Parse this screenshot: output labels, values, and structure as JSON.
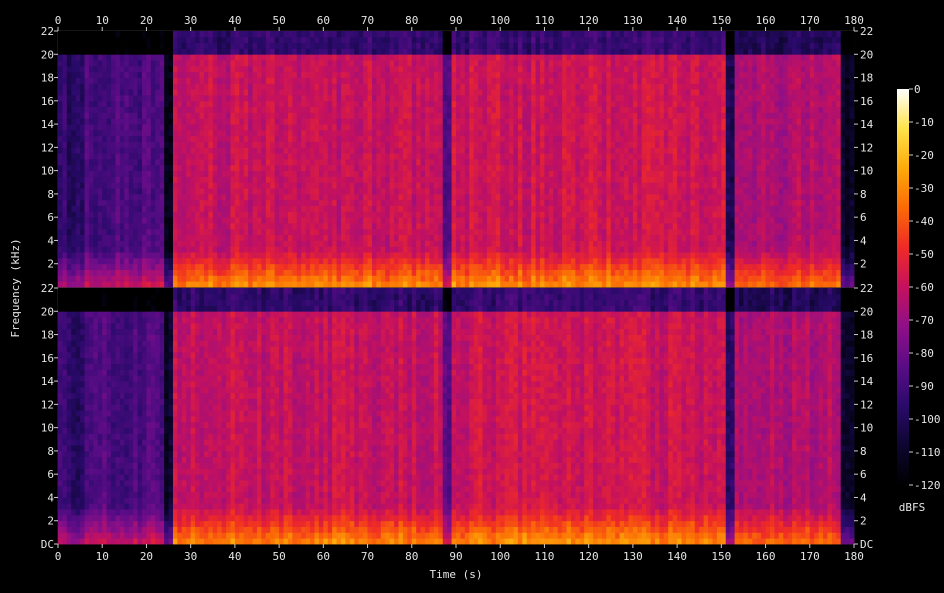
{
  "chart_data": {
    "type": "heatmap",
    "subtype": "spectrogram",
    "channels": 2,
    "xlabel": "Time (s)",
    "ylabel": "Frequency (kHz)",
    "colorbar_label": "dBFS",
    "xlim": [
      0,
      180
    ],
    "ylim": [
      0,
      22
    ],
    "x_ticks": [
      "0",
      "10",
      "20",
      "30",
      "40",
      "50",
      "60",
      "70",
      "80",
      "90",
      "100",
      "110",
      "120",
      "130",
      "140",
      "150",
      "160",
      "170",
      "180"
    ],
    "y_ticks_top": [
      "2",
      "4",
      "6",
      "8",
      "10",
      "12",
      "14",
      "16",
      "18",
      "20",
      "22"
    ],
    "y_ticks_bottom": [
      "DC",
      "2",
      "4",
      "6",
      "8",
      "10",
      "12",
      "14",
      "16",
      "18",
      "20",
      "22"
    ],
    "colorbar_range": [
      -120,
      0
    ],
    "colorbar_ticks": [
      "0",
      "-10",
      "-20",
      "-30",
      "-40",
      "-50",
      "-60",
      "-70",
      "-80",
      "-90",
      "-100",
      "-110",
      "-120"
    ],
    "colormap": [
      "#000000",
      "#0d0630",
      "#2a0a6b",
      "#5a0c86",
      "#8f0f87",
      "#c5115e",
      "#ef2a27",
      "#fb6a06",
      "#fdaa0a",
      "#ffe34a",
      "#ffffff"
    ],
    "segments": [
      {
        "start": 0,
        "end": 6,
        "level_db": -95,
        "rolloff_khz": 20
      },
      {
        "start": 6,
        "end": 24,
        "level_db": -88,
        "rolloff_khz": 20
      },
      {
        "start": 24,
        "end": 26,
        "level_db": -110,
        "rolloff_khz": 20
      },
      {
        "start": 26,
        "end": 87,
        "level_db": -60,
        "rolloff_khz": 20
      },
      {
        "start": 87,
        "end": 89,
        "level_db": -85,
        "rolloff_khz": 20
      },
      {
        "start": 89,
        "end": 151,
        "level_db": -58,
        "rolloff_khz": 20
      },
      {
        "start": 151,
        "end": 153,
        "level_db": -100,
        "rolloff_khz": 20
      },
      {
        "start": 153,
        "end": 177,
        "level_db": -65,
        "rolloff_khz": 20
      },
      {
        "start": 177,
        "end": 180,
        "level_db": -110,
        "rolloff_khz": 20
      }
    ]
  }
}
